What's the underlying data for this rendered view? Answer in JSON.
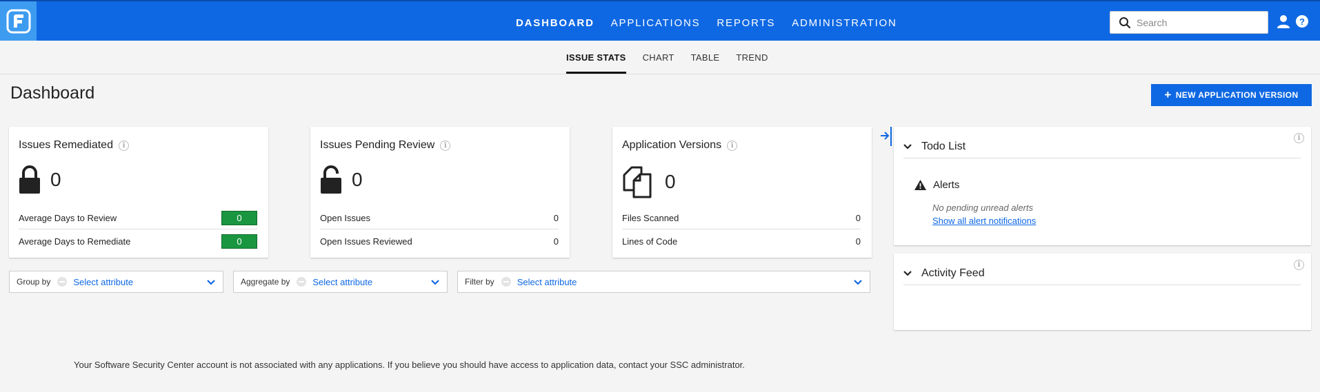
{
  "colors": {
    "nav_blue": "#0f68e3",
    "logo_blue": "#3d9bf0",
    "success_green": "#1a9640"
  },
  "topnav": {
    "logo": "fortify-logo",
    "items": [
      {
        "label": "DASHBOARD",
        "active": true
      },
      {
        "label": "APPLICATIONS",
        "active": false
      },
      {
        "label": "REPORTS",
        "active": false
      },
      {
        "label": "ADMINISTRATION",
        "active": false
      }
    ],
    "search_placeholder": "Search"
  },
  "subnav": {
    "items": [
      {
        "label": "ISSUE STATS",
        "active": true
      },
      {
        "label": "CHART",
        "active": false
      },
      {
        "label": "TABLE",
        "active": false
      },
      {
        "label": "TREND",
        "active": false
      }
    ]
  },
  "page": {
    "title": "Dashboard",
    "new_button_label": "NEW APPLICATION VERSION"
  },
  "cards": [
    {
      "title": "Issues Remediated",
      "icon": "lock-icon",
      "value": "0",
      "rows": [
        {
          "label": "Average Days to Review",
          "value": "0"
        },
        {
          "label": "Average Days to Remediate",
          "value": "0"
        }
      ]
    },
    {
      "title": "Issues Pending Review",
      "icon": "unlock-icon",
      "value": "0",
      "rows": [
        {
          "label": "Open Issues",
          "value": "0"
        },
        {
          "label": "Open Issues Reviewed",
          "value": "0"
        }
      ]
    },
    {
      "title": "Application Versions",
      "icon": "documents-icon",
      "value": "0",
      "rows": [
        {
          "label": "Files Scanned",
          "value": "0"
        },
        {
          "label": "Lines of Code",
          "value": "0"
        }
      ]
    }
  ],
  "filters": [
    {
      "label": "Group by",
      "value": "Select attribute"
    },
    {
      "label": "Aggregate by",
      "value": "Select attribute"
    },
    {
      "label": "Filter by",
      "value": "Select attribute"
    }
  ],
  "todo": {
    "title": "Todo List",
    "alerts_title": "Alerts",
    "alerts_message": "No pending unread alerts",
    "alerts_link": "Show all alert notifications"
  },
  "activity": {
    "title": "Activity Feed"
  },
  "footer_message": "Your Software Security Center account is not associated with any applications. If you believe you should have access to application data, contact your SSC administrator."
}
